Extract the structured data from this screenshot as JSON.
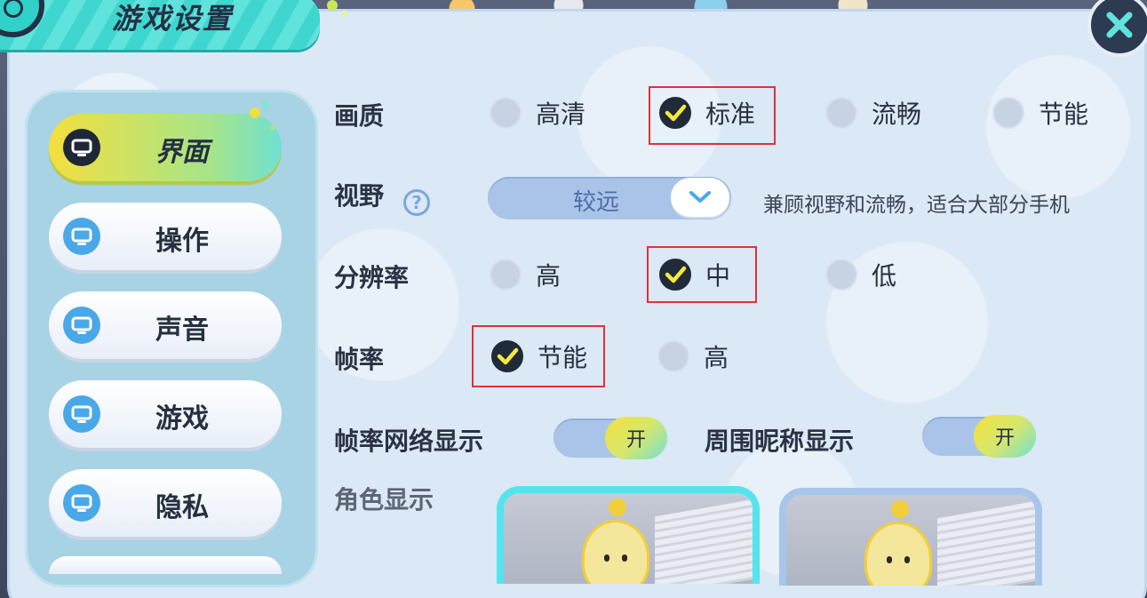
{
  "header": {
    "title": "游戏设置"
  },
  "sidebar": {
    "items": [
      {
        "label": "界面",
        "active": true
      },
      {
        "label": "操作",
        "active": false
      },
      {
        "label": "声音",
        "active": false
      },
      {
        "label": "游戏",
        "active": false
      },
      {
        "label": "隐私",
        "active": false
      }
    ]
  },
  "settings": {
    "quality": {
      "label": "画质",
      "options": [
        "高清",
        "标准",
        "流畅",
        "节能"
      ],
      "selected": "标准"
    },
    "fov": {
      "label": "视野",
      "value": "较远",
      "description": "兼顾视野和流畅，适合大部分手机"
    },
    "resolution": {
      "label": "分辨率",
      "options": [
        "高",
        "中",
        "低"
      ],
      "selected": "中"
    },
    "framerate": {
      "label": "帧率",
      "options": [
        "节能",
        "高"
      ],
      "selected": "节能"
    },
    "framerate_network_display": {
      "label": "帧率网络显示",
      "state": "开"
    },
    "nearby_nickname_display": {
      "label": "周围昵称显示",
      "state": "开"
    },
    "role_display": {
      "label": "角色显示"
    }
  },
  "colors": {
    "accent_teal": "#3ed6cf",
    "highlight_red": "#e0313a",
    "toggle_on": "#f5e13e"
  },
  "icons": {
    "nav": "monitor-icon",
    "close": "close-icon",
    "help": "question-icon",
    "dropdown": "chevron-down-icon",
    "check": "check-icon"
  }
}
